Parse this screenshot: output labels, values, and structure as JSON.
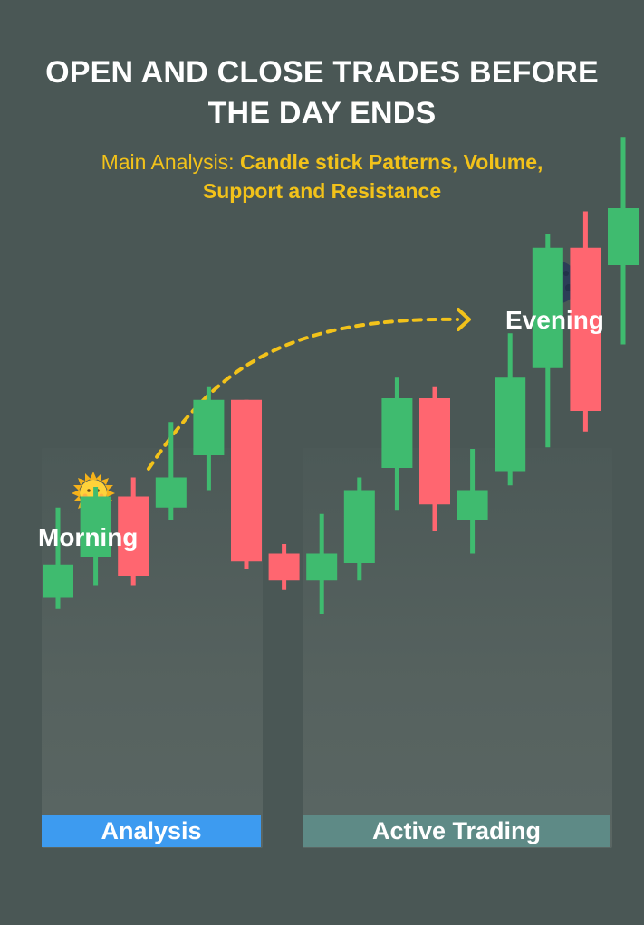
{
  "title": {
    "line1": "OPEN AND CLOSE TRADES BEFORE",
    "line2": "THE DAY ENDS"
  },
  "subtitle": {
    "prefix": "Main Analysis: ",
    "bold_line1": "Candle stick Patterns, Volume,",
    "bold_line2": "Support and Resistance"
  },
  "labels": {
    "morning": "Morning",
    "evening": "Evening"
  },
  "bands": {
    "analysis": "Analysis",
    "trading": "Active Trading"
  },
  "icons": {
    "morning": "sun-face-icon",
    "evening": "crescent-moon-icon",
    "arrow": "dashed-arrow"
  },
  "colors": {
    "background": "#4a5755",
    "bull": "#3fbb6f",
    "bear": "#ff6670",
    "accent": "#f2c21a",
    "analysis_band": "#3d9bf0",
    "trading_band": "#5e8a86"
  },
  "chart_data": {
    "type": "candlestick",
    "candles": [
      {
        "open": 11.0,
        "close": 13.1,
        "high": 16.7,
        "low": 10.3,
        "direction": "up"
      },
      {
        "open": 13.6,
        "close": 17.4,
        "high": 18.0,
        "low": 11.8,
        "direction": "up"
      },
      {
        "open": 17.4,
        "close": 12.4,
        "high": 18.6,
        "low": 11.8,
        "direction": "down"
      },
      {
        "open": 16.7,
        "close": 18.6,
        "high": 22.1,
        "low": 15.9,
        "direction": "up"
      },
      {
        "open": 20.0,
        "close": 23.5,
        "high": 24.3,
        "low": 17.8,
        "direction": "up"
      },
      {
        "open": 23.5,
        "close": 13.3,
        "high": 23.5,
        "low": 12.8,
        "direction": "down"
      },
      {
        "open": 13.8,
        "close": 12.1,
        "high": 14.4,
        "low": 11.5,
        "direction": "down"
      },
      {
        "open": 12.1,
        "close": 13.8,
        "high": 16.3,
        "low": 10.0,
        "direction": "up"
      },
      {
        "open": 13.2,
        "close": 17.8,
        "high": 18.6,
        "low": 12.1,
        "direction": "up"
      },
      {
        "open": 19.2,
        "close": 23.6,
        "high": 24.9,
        "low": 16.5,
        "direction": "up"
      },
      {
        "open": 23.6,
        "close": 16.9,
        "high": 24.3,
        "low": 15.2,
        "direction": "down"
      },
      {
        "open": 15.9,
        "close": 17.8,
        "high": 20.4,
        "low": 13.8,
        "direction": "up"
      },
      {
        "open": 19.0,
        "close": 24.9,
        "high": 27.7,
        "low": 18.1,
        "direction": "up"
      },
      {
        "open": 25.5,
        "close": 33.1,
        "high": 34.0,
        "low": 20.5,
        "direction": "up"
      },
      {
        "open": 33.1,
        "close": 22.8,
        "high": 35.4,
        "low": 21.5,
        "direction": "down"
      },
      {
        "open": 32.0,
        "close": 35.6,
        "high": 40.1,
        "low": 27.0,
        "direction": "up"
      }
    ],
    "sections": [
      "Analysis",
      "Active Trading"
    ]
  }
}
